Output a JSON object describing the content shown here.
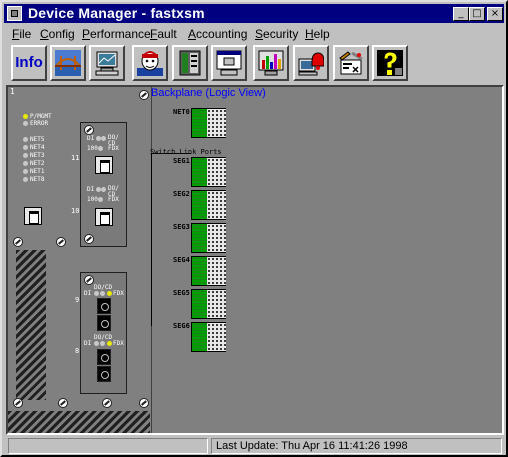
{
  "window": {
    "title": "Device Manager - fastxsm",
    "buttons": {
      "minimize": "_",
      "maximize": "□",
      "close": "×"
    }
  },
  "menu": [
    {
      "label": "File",
      "mnemonic": "F",
      "rest": "ile"
    },
    {
      "label": "Config",
      "mnemonic": "C",
      "rest": "onfig"
    },
    {
      "label": "Performance",
      "mnemonic": "P",
      "rest": "erformance"
    },
    {
      "label": "Fault",
      "mnemonic": "F",
      "rest": "ault"
    },
    {
      "label": "Accounting",
      "mnemonic": "A",
      "rest": "ccounting"
    },
    {
      "label": "Security",
      "mnemonic": "S",
      "rest": "ecurity"
    },
    {
      "label": "Help",
      "mnemonic": "H",
      "rest": "elp"
    }
  ],
  "toolbar": {
    "info_label": "Info",
    "tools": [
      "info",
      "bridge",
      "network-monitor",
      "user-face",
      "rack-device",
      "workstation-window",
      "statistics-chart",
      "alarm-bell",
      "config-tools",
      "help-question"
    ]
  },
  "chassis": {
    "slot_number": "1",
    "leds": [
      {
        "label": "P/MGMT",
        "on": true
      },
      {
        "label": "ERROR",
        "on": false
      }
    ],
    "net_leds": [
      "NET5",
      "NET4",
      "NET3",
      "NET2",
      "NET1",
      "NET8"
    ],
    "tx_module": {
      "ports": [
        {
          "number": "11",
          "led_labels": [
            "DI",
            "DO/",
            "CD",
            "100",
            "FDX"
          ]
        },
        {
          "number": "10",
          "led_labels": [
            "DI",
            "DO/",
            "CD",
            "100",
            "FDX"
          ]
        }
      ]
    },
    "fx_module": {
      "ports": [
        {
          "number": "9",
          "led_labels": [
            "DO/CD",
            "DI",
            "FDX"
          ]
        },
        {
          "number": "8",
          "led_labels": [
            "DO/CD",
            "DI",
            "FDX"
          ]
        }
      ]
    }
  },
  "backplane": {
    "title": "Backplane (Logic View)",
    "net_label": "NET0",
    "switch_label": "Switch Link Ports",
    "segments": [
      "SEG1",
      "SEG2",
      "SEG3",
      "SEG4",
      "SEG5",
      "SEG6"
    ]
  },
  "status": {
    "left": "",
    "right": "Last Update: Thu Apr 16 11:41:26 1998"
  },
  "colors": {
    "titlebar": "#000080",
    "backplane_title": "#0000ff",
    "segment_green": "#00a000",
    "led_on": "#e8e800"
  }
}
